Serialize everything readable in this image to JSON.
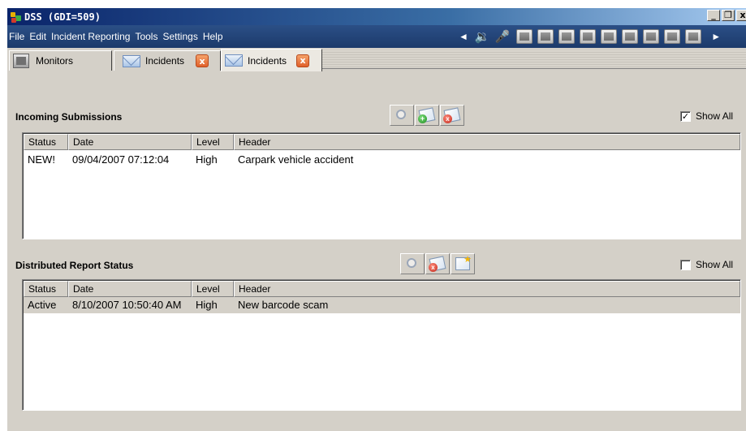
{
  "window": {
    "title": "DSS (GDI=509)",
    "min_label": "_",
    "max_label": "͈",
    "close_label": "x"
  },
  "menu": {
    "items": [
      "File",
      "Edit",
      "Incident Reporting",
      "Tools",
      "Settings",
      "Help"
    ]
  },
  "toolbar": {
    "left_arrow": "◄",
    "right_arrow": "►",
    "speaker_glyph": "🔉",
    "mic_glyph": "✐",
    "monitor_count": 9
  },
  "tabs": [
    {
      "label": "Monitors",
      "icon": "monitor-icon"
    },
    {
      "label": "Incidents",
      "icon": "envelope-icon",
      "close": "x"
    },
    {
      "label": "Incidents",
      "icon": "envelope-icon",
      "close": "x",
      "active": true
    }
  ],
  "incoming": {
    "title": "Incoming Submissions",
    "show_all_label": "Show All",
    "show_all_checked": true,
    "check_mark": "✓",
    "columns": [
      "Status",
      "Date",
      "Level",
      "Header"
    ],
    "rows": [
      {
        "status": "NEW!",
        "date": "09/04/2007 07:12:04",
        "level": "High",
        "header": "Carpark vehicle accident"
      }
    ]
  },
  "distributed": {
    "title": "Distributed Report Status",
    "show_all_label": "Show All",
    "show_all_checked": false,
    "columns": [
      "Status",
      "Date",
      "Level",
      "Header"
    ],
    "rows": [
      {
        "status": "Active",
        "date": "8/10/2007 10:50:40 AM",
        "level": "High",
        "header": "New barcode scam"
      }
    ]
  },
  "colors": {
    "titlebar_start": "#0a246a",
    "menubar": "#1c3a6b",
    "face": "#d4d0c8",
    "close_tab": "#e0602a"
  }
}
